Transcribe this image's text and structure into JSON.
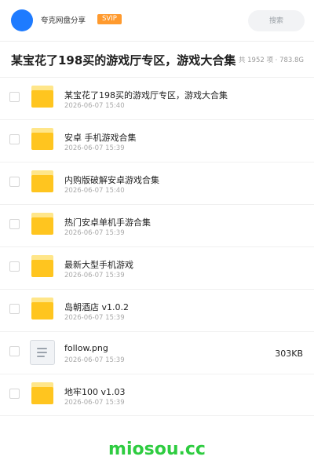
{
  "header": {
    "brand": "夸克网盘分享",
    "badge": "SVIP",
    "search_placeholder": "搜索",
    "accent_color": "#1e7bff",
    "badge_color": "#ff9a2e"
  },
  "page": {
    "title": "某宝花了198买的游戏厅专区，游戏大合集",
    "meta": "共 1952 项 · 783.8G"
  },
  "files": [
    {
      "type": "folder",
      "icon": "folder-icon",
      "name": "某宝花了198买的游戏厅专区，游戏大合集",
      "date": "2026-06-07 15:40",
      "size": ""
    },
    {
      "type": "folder",
      "icon": "folder-icon",
      "name": "安卓 手机游戏合集",
      "date": "2026-06-07 15:39",
      "size": ""
    },
    {
      "type": "folder",
      "icon": "folder-icon",
      "name": "内购版破解安卓游戏合集",
      "date": "2026-06-07 15:40",
      "size": ""
    },
    {
      "type": "folder",
      "icon": "folder-icon",
      "name": "热门安卓单机手游合集",
      "date": "2026-06-07 15:39",
      "size": ""
    },
    {
      "type": "folder",
      "icon": "folder-icon",
      "name": "最新大型手机游戏",
      "date": "2026-06-07 15:39",
      "size": ""
    },
    {
      "type": "folder",
      "icon": "folder-icon",
      "name": "岛朝酒店 v1.0.2",
      "date": "2026-06-07 15:39",
      "size": ""
    },
    {
      "type": "file",
      "icon": "document-icon",
      "name": "follow.png",
      "date": "2026-06-07 15:39",
      "size": "303KB"
    },
    {
      "type": "folder",
      "icon": "folder-icon",
      "name": "地牢100 v1.03",
      "date": "2026-06-07 15:39",
      "size": ""
    }
  ],
  "watermark": "miosou.cc"
}
